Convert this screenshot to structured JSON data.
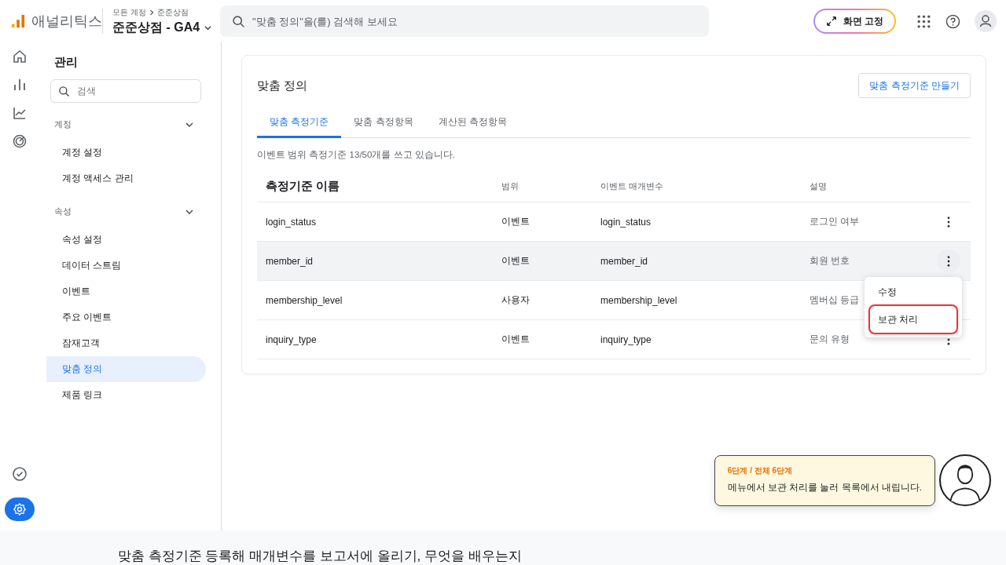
{
  "header": {
    "logo_text": "애널리틱스",
    "breadcrumb": [
      "모든 계정",
      "준준상점"
    ],
    "property": "준준상점 - GA4",
    "search_placeholder": "\"맞춤 정의\"을(를) 검색해 보세요",
    "pin_button": "화면 고정"
  },
  "rail": [
    {
      "kind": "home",
      "selected": false
    },
    {
      "kind": "reports",
      "selected": false
    },
    {
      "kind": "explore",
      "selected": false
    },
    {
      "kind": "advertising",
      "selected": false
    },
    {
      "kind": "check",
      "selected": false
    },
    {
      "kind": "settings",
      "selected": true
    }
  ],
  "sidebar": {
    "title": "관리",
    "search_placeholder": "검색",
    "sections": [
      {
        "label": "계정",
        "expanded": true,
        "items": [
          {
            "label": "계정 설정",
            "selected": false
          },
          {
            "label": "계정 액세스 관리",
            "selected": false
          }
        ]
      },
      {
        "label": "속성",
        "expanded": true,
        "items": [
          {
            "label": "속성 설정",
            "selected": false
          },
          {
            "label": "데이터 스트림",
            "selected": false
          },
          {
            "label": "이벤트",
            "selected": false
          },
          {
            "label": "주요 이벤트",
            "selected": false
          },
          {
            "label": "잠재고객",
            "selected": false
          },
          {
            "label": "맞춤 정의",
            "selected": true
          },
          {
            "label": "제품 링크",
            "selected": false
          }
        ]
      }
    ]
  },
  "main": {
    "title": "맞춤 정의",
    "create_button": "맞춤 측정기준 만들기",
    "tabs": [
      {
        "label": "맞춤 측정기준",
        "selected": true
      },
      {
        "label": "맞춤 측정항목",
        "selected": false
      },
      {
        "label": "계산된 측정항목",
        "selected": false
      }
    ],
    "usage_note": "이벤트 범위 측정기준 13/50개를 쓰고 있습니다.",
    "table": {
      "columns": [
        "측정기준 이름",
        "범위",
        "이벤트 매개변수",
        "설명"
      ],
      "rows": [
        {
          "cells": [
            "login_status",
            "이벤트",
            "login_status",
            "로그인 여부"
          ],
          "hovered": false
        },
        {
          "cells": [
            "member_id",
            "이벤트",
            "member_id",
            "회원 번호"
          ],
          "hovered": true
        },
        {
          "cells": [
            "membership_level",
            "사용자",
            "membership_level",
            "멤버십 등급"
          ],
          "hovered": false
        },
        {
          "cells": [
            "inquiry_type",
            "이벤트",
            "inquiry_type",
            "문의 유형"
          ],
          "hovered": false
        }
      ]
    },
    "row_menu": {
      "items": [
        {
          "label": "수정",
          "highlighted": false
        },
        {
          "label": "보관 처리",
          "highlighted": true
        }
      ]
    }
  },
  "tour": {
    "step": "6단계 / 전체 6단계",
    "message": "메뉴에서 보관 처리를 눌러 목록에서 내립니다."
  },
  "caption": "맞춤 측정기준 등록해 매개변수를 보고서에 올리기, 무엇을 배우는지"
}
